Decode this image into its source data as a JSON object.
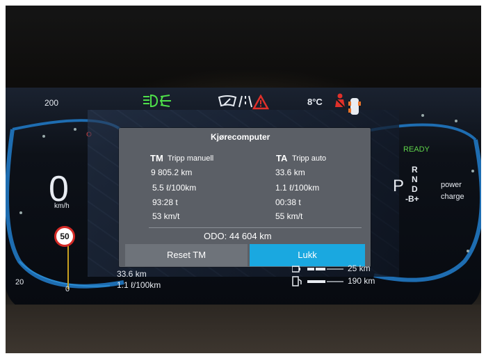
{
  "speed": {
    "value": "0",
    "unit": "km/h",
    "scale_200": "200",
    "scale_20": "20",
    "scale_0": "0"
  },
  "speed_limit": "50",
  "temperature": "8°C",
  "status": {
    "ready": "READY",
    "gears": [
      "P",
      "R",
      "N",
      "D",
      "-B+"
    ],
    "power": "power",
    "charge": "charge"
  },
  "dialog": {
    "title": "Kjørecomputer",
    "tm_code": "TM",
    "tm_label": "Tripp manuell",
    "ta_code": "TA",
    "ta_label": "Tripp auto",
    "tm_values": [
      "9 805.2 km",
      "5.5 ℓ/100km",
      "93:28 t",
      "53 km/t"
    ],
    "ta_values": [
      "33.6 km",
      "1.1 ℓ/100km",
      "00:38 t",
      "55 km/t"
    ],
    "odo": "ODO: 44 604 km",
    "reset_label": "Reset TM",
    "close_label": "Lukk"
  },
  "bottom_left": {
    "distance": "33.6 km",
    "consumption": "1.1 ℓ/100km"
  },
  "range": {
    "electric": "25 km",
    "fuel": "190 km"
  },
  "colors": {
    "accent": "#1aa8e0",
    "ready": "#5fd44a",
    "warning_red": "#e0302a"
  }
}
